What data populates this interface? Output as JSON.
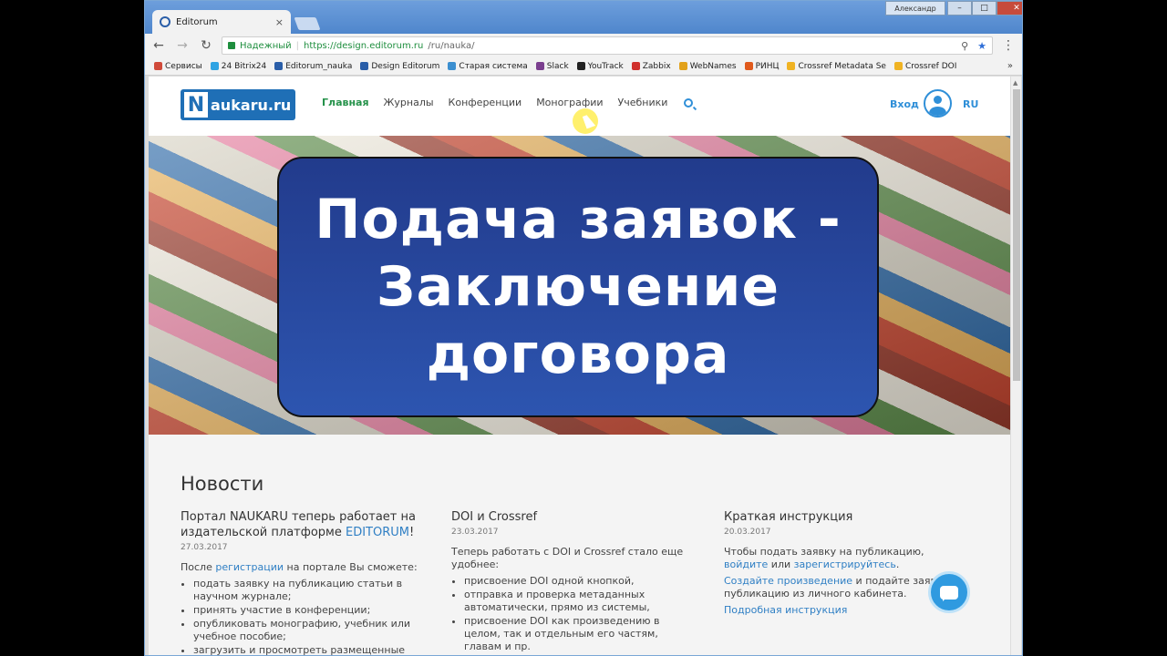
{
  "browser": {
    "tab_title": "Editorum",
    "tab_close": "×",
    "user_name": "Александр",
    "win_controls": {
      "minimize": "–",
      "maximize": "□",
      "close": "✕"
    },
    "nav": {
      "back": "←",
      "forward": "→",
      "reload": "↻"
    },
    "secure_label": "Надежный",
    "url_host": "https://design.editorum.ru",
    "url_path": "/ru/nauka/",
    "menu_glyph": "⋮",
    "key_glyph": "⚲",
    "star_glyph": "★",
    "bookmarks": [
      {
        "label": "Сервисы",
        "color": "#d04a3a"
      },
      {
        "label": "24 Bitrix24",
        "color": "#2fa3e3"
      },
      {
        "label": "Editorum_nauka",
        "color": "#2a5ea8"
      },
      {
        "label": "Design Editorum",
        "color": "#2a5ea8"
      },
      {
        "label": "Старая система",
        "color": "#3c8fd0"
      },
      {
        "label": "Slack",
        "color": "#7b3f8f"
      },
      {
        "label": "YouTrack",
        "color": "#222222"
      },
      {
        "label": "Zabbix",
        "color": "#d0312d"
      },
      {
        "label": "WebNames",
        "color": "#e2a11a"
      },
      {
        "label": "РИНЦ",
        "color": "#e05a1c"
      },
      {
        "label": "Crossref Metadata Se",
        "color": "#f0b323"
      },
      {
        "label": "Crossref DOI",
        "color": "#f0b323"
      }
    ],
    "bookmarks_more": "»"
  },
  "site": {
    "logo_letter": "N",
    "logo_text": "aukaru.ru",
    "nav": [
      "Главная",
      "Журналы",
      "Конференции",
      "Монографии",
      "Учебники"
    ],
    "login": "Вход",
    "lang": "RU"
  },
  "hero": {
    "lines": [
      "Подача заявок -",
      "Заключение",
      "договора"
    ]
  },
  "news": {
    "heading": "Новости",
    "col1": {
      "title_part1": "Портал NAUKARU теперь работает на издательской платформе ",
      "title_link": "EDITORUM",
      "title_end": "!",
      "date": "27.03.2017",
      "intro_part1": "После ",
      "intro_link": "регистрации",
      "intro_part2": " на портале Вы сможете:",
      "items": [
        "подать заявку на публикацию статьи в научном журнале;",
        "принять участие в конференции;",
        "опубликовать монографию, учебник или учебное пособие;",
        "загрузить и просмотреть размещенные"
      ]
    },
    "col2": {
      "title": "DOI и Crossref",
      "date": "23.03.2017",
      "intro": "Теперь работать с DOI и Crossref стало еще удобнее:",
      "items": [
        "присвоение DOI одной кнопкой,",
        "отправка и проверка метаданных автоматически, прямо из системы,",
        "присвоение DOI как произведению в целом, так и отдельным его частям, главам и пр."
      ]
    },
    "col3": {
      "title": "Краткая инструкция",
      "date": "20.03.2017",
      "line1_part1": "Чтобы подать заявку на публикацию, ",
      "line1_link1": "войдите",
      "line1_part2": " или ",
      "line1_link2": "зарегистрируйтесь",
      "line1_end": ".",
      "line2_link": "Создайте произведение",
      "line2_part": " и подайте заявку на публикацию из личного кабинета.",
      "line3_link": "Подробная инструкция"
    }
  }
}
